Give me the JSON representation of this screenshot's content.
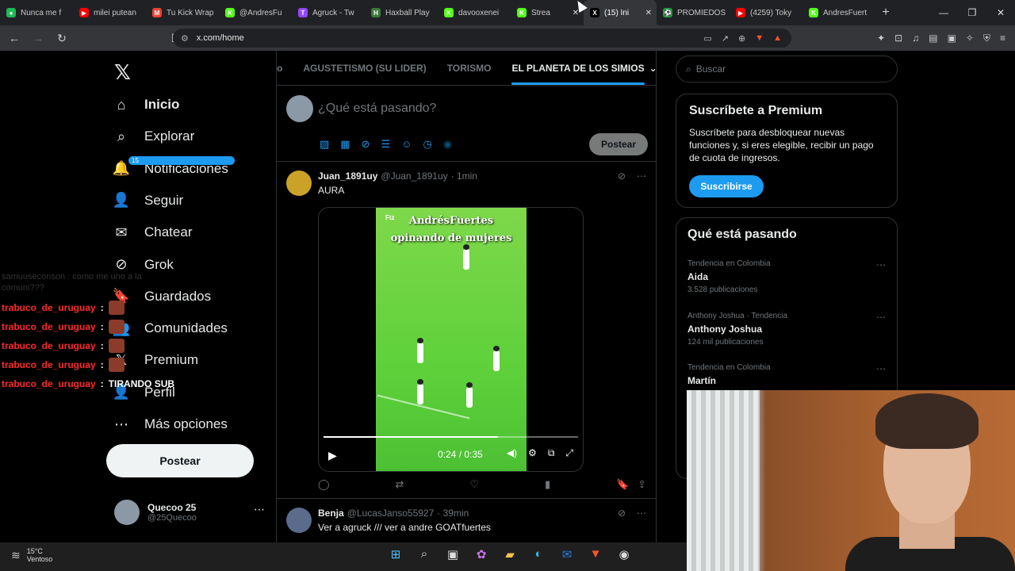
{
  "browser": {
    "tabs": [
      {
        "label": "Nunca me f",
        "color": "#1db954",
        "glyph": "●"
      },
      {
        "label": "milei putean",
        "color": "#ff0000",
        "glyph": "▶"
      },
      {
        "label": "Tu Kick Wrap",
        "color": "#ea4335",
        "glyph": "M"
      },
      {
        "label": "@AndresFu",
        "color": "#53fc18",
        "glyph": "K"
      },
      {
        "label": "Agruck - Tw",
        "color": "#9146ff",
        "glyph": "T"
      },
      {
        "label": "Haxball Play",
        "color": "#3c7a3c",
        "glyph": "H"
      },
      {
        "label": "davooxenei",
        "color": "#53fc18",
        "glyph": "K"
      },
      {
        "label": "Strea",
        "color": "#53fc18",
        "glyph": "K"
      },
      {
        "label": "(15) Ini",
        "color": "#000000",
        "glyph": "X"
      },
      {
        "label": "PROMIEDOS",
        "color": "#1b9c3a",
        "glyph": "⚽"
      },
      {
        "label": "(4259) Toky",
        "color": "#ff0000",
        "glyph": "▶"
      },
      {
        "label": "AndresFuert",
        "color": "#53fc18",
        "glyph": "K"
      }
    ],
    "url": "x.com/home"
  },
  "sidebar": {
    "logo": "𝕏",
    "items": [
      {
        "label": "Inicio",
        "icon": "⌂"
      },
      {
        "label": "Explorar",
        "icon": "⌕"
      },
      {
        "label": "Notificaciones",
        "icon": "🔔",
        "badge": "15"
      },
      {
        "label": "Seguir",
        "icon": "👤"
      },
      {
        "label": "Chatear",
        "icon": "✉"
      },
      {
        "label": "Grok",
        "icon": "⊘"
      },
      {
        "label": "Guardados",
        "icon": "🔖"
      },
      {
        "label": "Comunidades",
        "icon": "👥"
      },
      {
        "label": "Premium",
        "icon": "𝕏"
      },
      {
        "label": "Perfil",
        "icon": "👤"
      },
      {
        "label": "Más opciones",
        "icon": "⋯"
      }
    ],
    "post_label": "Postear",
    "account": {
      "name": "Quecoo 25",
      "handle": "@25Quecoo"
    }
  },
  "chat": {
    "faint": "samuuseconson : como me uno a la comuni???",
    "lines": [
      {
        "user": "trabuco_de_uruguay",
        "msg": ""
      },
      {
        "user": "trabuco_de_uruguay",
        "msg": ""
      },
      {
        "user": "trabuco_de_uruguay",
        "msg": ""
      },
      {
        "user": "trabuco_de_uruguay",
        "msg": ""
      },
      {
        "user": "trabuco_de_uruguay",
        "msg": "TIRANDO SUB"
      }
    ]
  },
  "main": {
    "tabs": [
      "o",
      "AGUSTETISMO (SU LIDER)",
      "TORISMO",
      "EL PLANETA DE LOS SIMIOS"
    ],
    "compose_placeholder": "¿Qué está pasando?",
    "compose_post": "Postear",
    "tweets": [
      {
        "name": "Juan_1891uy",
        "handle": "@Juan_1891uy",
        "time": "· 1min",
        "text": "AURA",
        "video_title_1": "AndrésFuertes",
        "video_title_2": "opinando de mujeres",
        "video_tag": "Ftz",
        "video_time": "0:24 / 0:35",
        "video_progress": 0.6857
      },
      {
        "name": "Benja",
        "handle": "@LucasJanso55927",
        "time": "· 39min",
        "text": "Ver a agruck /// ver a andre GOATfuertes"
      }
    ]
  },
  "right": {
    "search_placeholder": "Buscar",
    "premium_title": "Suscríbete a Premium",
    "premium_text": "Suscríbete para desbloquear nuevas funciones y, si eres elegible, recibir un pago de cuota de ingresos.",
    "premium_button": "Suscribirse",
    "trends_title": "Qué está pasando",
    "trends": [
      {
        "context": "Tendencia en Colombia",
        "name": "Aida",
        "count": "3.528 publicaciones"
      },
      {
        "context": "Anthony Joshua · Tendencia",
        "name": "Anthony Joshua",
        "count": "124 mil publicaciones"
      },
      {
        "context": "Tendencia en Colombia",
        "name": "Martín",
        "count": ""
      }
    ]
  },
  "taskbar": {
    "temp": "15°C",
    "weather": "Ventoso"
  }
}
